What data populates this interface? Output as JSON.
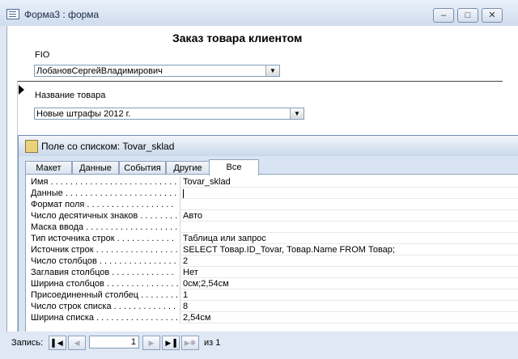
{
  "window": {
    "title": "Форма3 : форма",
    "controls": [
      "‒",
      "□",
      "✕"
    ]
  },
  "form": {
    "title": "Заказ товара клиентом",
    "fio_label": "FIO",
    "fio_value": "ЛобановСергейВладимирович",
    "product_label": "Название товара",
    "product_value": "Новые штрафы 2012 г."
  },
  "property_sheet": {
    "title": "Поле со списком: Tovar_sklad",
    "tabs": [
      "Макет",
      "Данные",
      "События",
      "Другие",
      "Все"
    ],
    "active_tab": "Все",
    "rows": [
      {
        "name": "Имя . . . . . . . . . . . . . . . . . . . . . . . . . .",
        "value": "Tovar_sklad"
      },
      {
        "name": "Данные . . . . . . . . . . . . . . . . . . . . . . .",
        "value": ""
      },
      {
        "name": "Формат поля . . . . . . . . . . . . . . . . . .",
        "value": ""
      },
      {
        "name": "Число десятичных знаков . . . . . . . .",
        "value": "Авто"
      },
      {
        "name": "Маска ввода . . . . . . . . . . . . . . . . . . .",
        "value": ""
      },
      {
        "name": "Тип источника строк . . . . . . . . . . . .",
        "value": "Таблица или запрос"
      },
      {
        "name": "Источник строк . . . . . . . . . . . . . . . . .",
        "value": "SELECT Товар.ID_Tovar, Товар.Name FROM Товар;"
      },
      {
        "name": "Число столбцов . . . . . . . . . . . . . . . .",
        "value": "2"
      },
      {
        "name": "Заглавия столбцов . . . . . . . . . . . . .",
        "value": "Нет"
      },
      {
        "name": "Ширина столбцов . . . . . . . . . . . . . . .",
        "value": "0см;2,54см"
      },
      {
        "name": "Присоединенный столбец . . . . . . . . .",
        "value": "1"
      },
      {
        "name": "Число строк списка . . . . . . . . . . . . .",
        "value": "8"
      },
      {
        "name": "Ширина списка . . . . . . . . . . . . . . . . .",
        "value": "2,54см"
      }
    ]
  },
  "record_nav": {
    "label": "Запись:",
    "current": "1",
    "of_label": "из  1"
  }
}
